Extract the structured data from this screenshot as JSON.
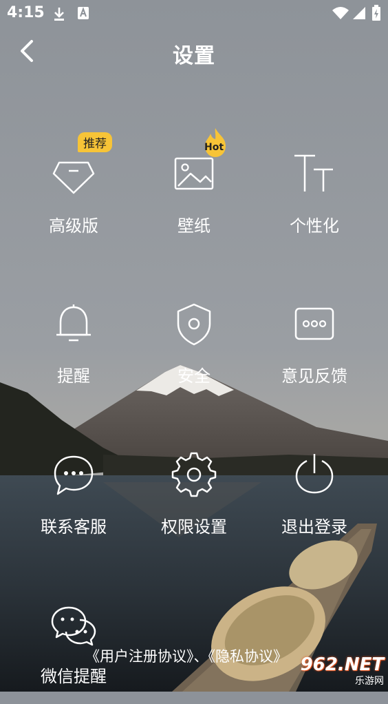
{
  "status": {
    "time": "4:15"
  },
  "header": {
    "title": "设置"
  },
  "items": [
    {
      "label": "高级版",
      "badge": "推荐"
    },
    {
      "label": "壁纸",
      "badge": "Hot"
    },
    {
      "label": "个性化"
    },
    {
      "label": "提醒"
    },
    {
      "label": "安全"
    },
    {
      "label": "意见反馈"
    },
    {
      "label": "联系客服"
    },
    {
      "label": "权限设置"
    },
    {
      "label": "退出登录"
    },
    {
      "label": "微信提醒"
    }
  ],
  "footer": {
    "user_agreement": "《用户注册协议》",
    "separator": "、",
    "privacy": "《隐私协议》"
  },
  "watermark": {
    "main": "962.NET",
    "sub": "乐游网"
  }
}
